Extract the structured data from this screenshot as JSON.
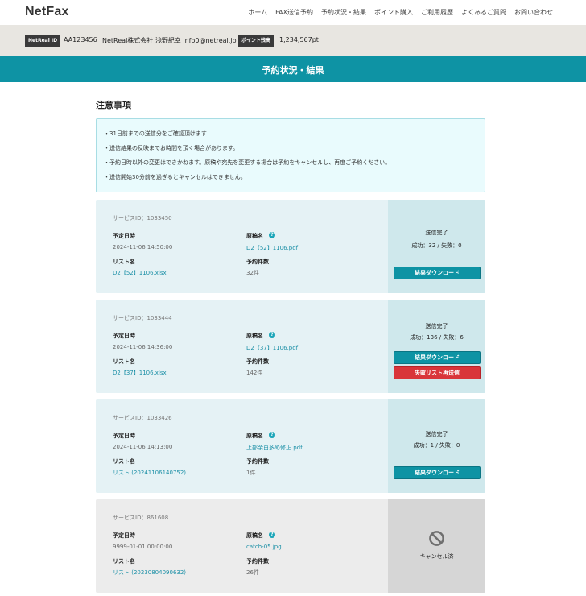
{
  "app": {
    "logo": "NetFax"
  },
  "nav": [
    "ホーム",
    "FAX送信予約",
    "予約状況・結果",
    "ポイント購入",
    "ご利用履歴",
    "よくあるご質問",
    "お問い合わせ"
  ],
  "account": {
    "id_tag": "NetReal ID",
    "id": "AA123456",
    "user": "NetReal株式会社 浅野紀幸 info0@netreal.jp",
    "points_tag": "ポイント残高",
    "points": "1,234,567pt"
  },
  "page_title": "予約状況・結果",
  "notes": {
    "title": "注意事項",
    "items": [
      "・31日前までの送信分をご確認頂けます",
      "・送信結果の反映までお時間を頂く場合があります。",
      "・予約日時以外の変更はできかねます。原稿や宛先を変更する場合は予約をキャンセルし、再度ご予約ください。",
      "・送信開始30分前を過ぎるとキャンセルはできません。"
    ]
  },
  "labels": {
    "scheduled": "予定日時",
    "document": "原稿名",
    "list": "リスト名",
    "count": "予約件数",
    "help": "?"
  },
  "reservations": [
    {
      "service_id": "サービスID：1033450",
      "scheduled": "2024-11-06 14:50:00",
      "document": "D2【52】1106.pdf",
      "list": "D2【52】1106.xlsx",
      "count": "32件",
      "status": "送信完了",
      "result": "成功：32 / 失敗：0",
      "download_label": "結果ダウンロード"
    },
    {
      "service_id": "サービスID：1033444",
      "scheduled": "2024-11-06 14:36:00",
      "document": "D2【37】1106.pdf",
      "list": "D2【37】1106.xlsx",
      "count": "142件",
      "status": "送信完了",
      "result": "成功：136 / 失敗：6",
      "download_label": "結果ダウンロード",
      "resend_label": "失敗リスト再送信"
    },
    {
      "service_id": "サービスID：1033426",
      "scheduled": "2024-11-06 14:13:00",
      "document": "上部余白多め修正.pdf",
      "list": "リスト (20241106140752)",
      "count": "1件",
      "status": "送信完了",
      "result": "成功：1 / 失敗：0",
      "download_label": "結果ダウンロード"
    },
    {
      "service_id": "サービスID：861608",
      "scheduled": "9999-01-01 00:00:00",
      "document": "catch-05.jpg",
      "list": "リスト (20230804090632)",
      "count": "26件",
      "status": "キャンセル済"
    }
  ],
  "colors": {
    "brand": "#0e93a4",
    "danger": "#d9353a",
    "link": "#1a8fa6",
    "card_bg": "#e5f2f5",
    "card_status_bg": "#cfe8ec",
    "cancelled_bg": "#ececec"
  },
  "icons": {
    "help": "question-circle-icon",
    "cancelled": "prohibited-icon"
  }
}
